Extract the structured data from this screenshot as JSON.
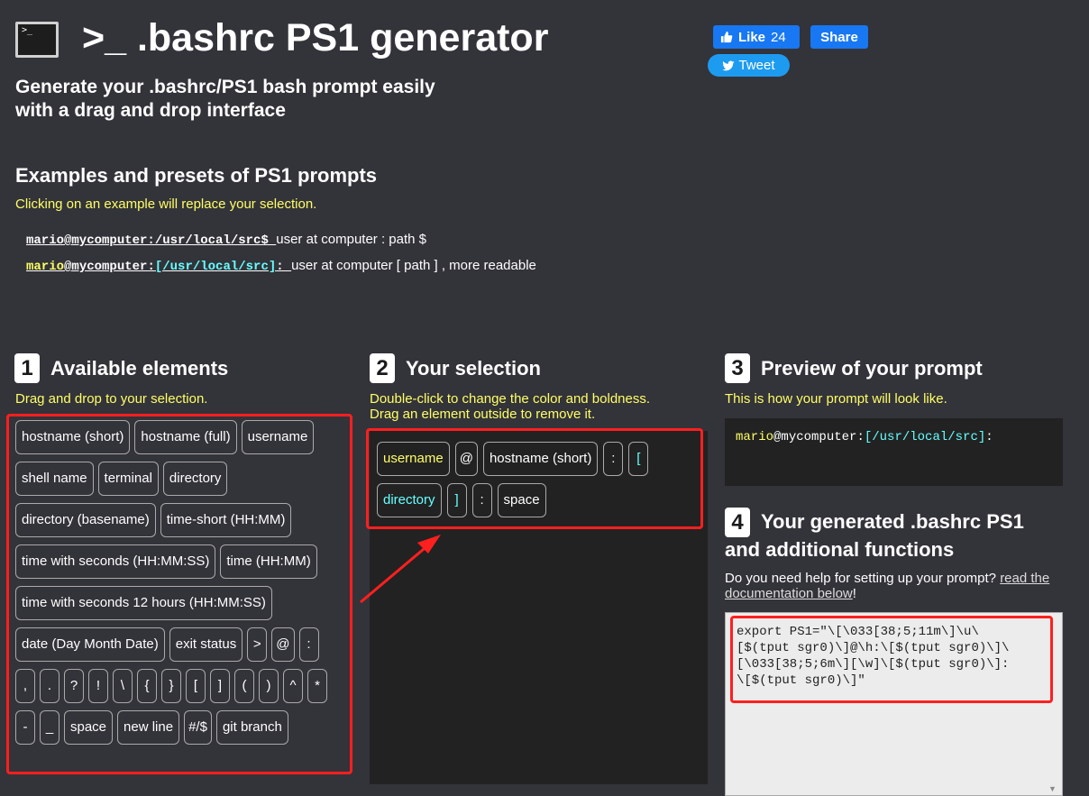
{
  "header": {
    "icon_text": ">_",
    "title": ">_ .bashrc PS1 generator",
    "subtitle_line1": "Generate your .bashrc/PS1 bash prompt easily",
    "subtitle_line2": "with a drag and drop interface"
  },
  "social": {
    "like_label": "Like",
    "like_count": "24",
    "share_label": "Share",
    "tweet_label": "Tweet"
  },
  "examples": {
    "heading": "Examples and presets of PS1 prompts",
    "note": "Clicking on an example will replace your selection.",
    "items": [
      {
        "prompt": "mario@mycomputer:/usr/local/src$ ",
        "description": "user at computer : path $"
      },
      {
        "user": "mario",
        "at": "@",
        "host": "mycomputer",
        "colon": ":",
        "path": "[/usr/local/src]",
        "tail": ": ",
        "description": "user at computer [ path ] , more readable"
      }
    ]
  },
  "section1": {
    "number": "1",
    "heading": "Available elements",
    "note": "Drag and drop to your selection.",
    "elements": [
      "hostname (short)",
      "hostname (full)",
      "username",
      "shell name",
      "terminal",
      "directory",
      "directory (basename)",
      "time-short (HH:MM)",
      "time with seconds (HH:MM:SS)",
      "time (HH:MM)",
      "time with seconds 12 hours (HH:MM:SS)",
      "date (Day Month Date)",
      "exit status",
      ">",
      "@",
      ":",
      ",",
      ".",
      "?",
      "!",
      "\\",
      "{",
      "}",
      "[",
      "]",
      "(",
      ")",
      "^",
      "*",
      "-",
      "_",
      "space",
      "new line",
      "#/$",
      "git branch"
    ]
  },
  "section2": {
    "number": "2",
    "heading": "Your selection",
    "note_line1": "Double-click to change the color and boldness.",
    "note_line2": "Drag an element outside to remove it.",
    "selection": [
      {
        "label": "username",
        "color": "#ffff66"
      },
      {
        "label": "@",
        "color": "#ffffff"
      },
      {
        "label": "hostname (short)",
        "color": "#ffffff"
      },
      {
        "label": ":",
        "color": "#ffffff"
      },
      {
        "label": "[",
        "color": "#66ffff"
      },
      {
        "label": "directory",
        "color": "#66ffff"
      },
      {
        "label": "]",
        "color": "#66ffff"
      },
      {
        "label": ":",
        "color": "#ffffff"
      },
      {
        "label": "space",
        "color": "#ffffff"
      }
    ]
  },
  "section3": {
    "number": "3",
    "heading": "Preview of your prompt",
    "note": "This is how your prompt will look like.",
    "preview": {
      "user": "mario",
      "at": "@",
      "host": "mycomputer",
      "colon": ":",
      "path": "[/usr/local/src]",
      "tail": ":"
    }
  },
  "section4": {
    "number": "4",
    "heading_line1": "Your generated .bashrc PS1",
    "heading_line2": "and additional functions",
    "help_text": "Do you need help for setting up your prompt? ",
    "help_link": "read the documentation below",
    "help_end": "!",
    "code": "export PS1=\"\\[\\033[38;5;11m\\]\\u\\\n[$(tput sgr0)\\]@\\h:\\[$(tput sgr0)\\]\\\n[\\033[38;5;6m\\][\\w]\\[$(tput sgr0)\\]:\n\\[$(tput sgr0)\\]\""
  },
  "colors": {
    "background": "#33333a",
    "panel": "#222222",
    "note_yellow": "#ffff66",
    "cyan": "#66ffff",
    "annotation_red": "#ff1f1f",
    "facebook": "#1877f2",
    "twitter": "#1d9bf0"
  }
}
